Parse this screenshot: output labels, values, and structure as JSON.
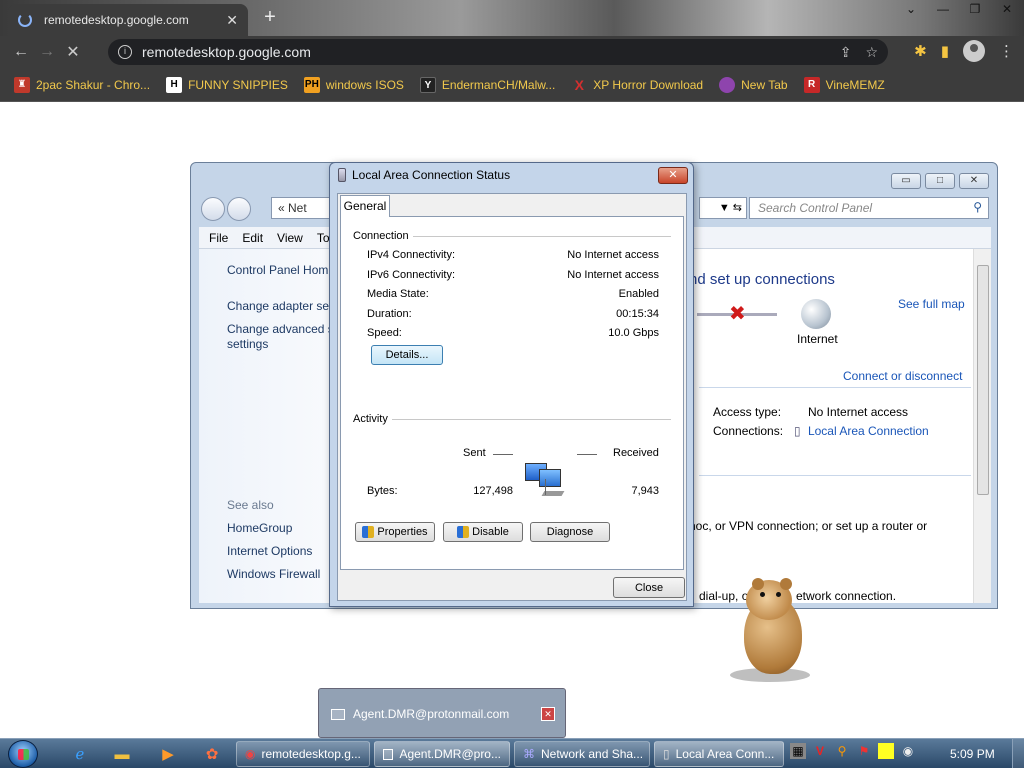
{
  "browser": {
    "tab_title": "remotedesktop.google.com",
    "url": "remotedesktop.google.com",
    "bookmarks": [
      {
        "label": "2pac Shakur - Chro...",
        "fav": "",
        "color": "#c0392b"
      },
      {
        "label": "FUNNY SNIPPIES",
        "fav": "H",
        "color": "#ffffff"
      },
      {
        "label": "windows ISOS",
        "fav": "PH",
        "color": "#f0a020"
      },
      {
        "label": "EndermanCH/Malw...",
        "fav": "Y",
        "color": "#222222"
      },
      {
        "label": "XP Horror Download",
        "fav": "X",
        "color": "#d32f2f"
      },
      {
        "label": "New Tab",
        "fav": "",
        "color": "#8e44ad"
      },
      {
        "label": "VineMEMZ",
        "fav": "R",
        "color": "#c62828"
      }
    ]
  },
  "control_panel": {
    "address_text": "« Net",
    "search_placeholder": "Search Control Panel",
    "menu": [
      "File",
      "Edit",
      "View",
      "To"
    ],
    "left_links": [
      "Control Panel Hom",
      "Change adapter set",
      "Change advanced s",
      "settings"
    ],
    "see_also": "See also",
    "see_also_links": [
      "HomeGroup",
      "Internet Options",
      "Windows Firewall"
    ],
    "heading": "nd set up connections",
    "see_full_map": "See full map",
    "internet": "Internet",
    "connect_disconnect": "Connect or disconnect",
    "access_type_label": "Access type:",
    "access_type_value": "No Internet access",
    "connections_label": "Connections:",
    "connections_value": "Local Area Connection",
    "line1": "hoc, or VPN connection; or set up a router or",
    "line2": "dial-up, or",
    "line3": "etwork connection."
  },
  "status_dialog": {
    "title": "Local Area Connection Status",
    "tab": "General",
    "connection_group": "Connection",
    "rows": [
      {
        "label": "IPv4 Connectivity:",
        "value": "No Internet access"
      },
      {
        "label": "IPv6 Connectivity:",
        "value": "No Internet access"
      },
      {
        "label": "Media State:",
        "value": "Enabled"
      },
      {
        "label": "Duration:",
        "value": "00:15:34"
      },
      {
        "label": "Speed:",
        "value": "10.0 Gbps"
      }
    ],
    "details_btn": "Details...",
    "activity_group": "Activity",
    "sent": "Sent",
    "received": "Received",
    "bytes_label": "Bytes:",
    "bytes_sent": "127,498",
    "bytes_received": "7,943",
    "properties_btn": "Properties",
    "disable_btn": "Disable",
    "diagnose_btn": "Diagnose",
    "close_btn": "Close"
  },
  "thumbnail": {
    "label": "Agent.DMR@protonmail.com"
  },
  "taskbar": {
    "buttons": [
      "remotedesktop.g...",
      "Agent.DMR@pro...",
      "Network and Sha...",
      "Local Area Conn..."
    ],
    "clock": "5:09 PM"
  }
}
